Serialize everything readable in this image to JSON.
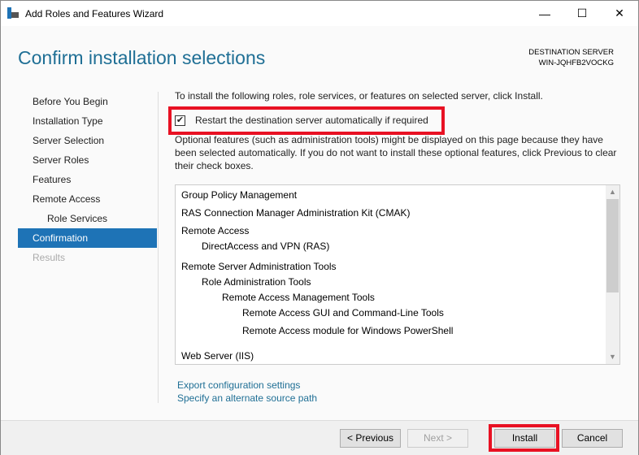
{
  "window": {
    "title": "Add Roles and Features Wizard",
    "minimize": "—",
    "maximize": "☐",
    "close": "✕"
  },
  "header": {
    "title": "Confirm installation selections",
    "destination_label": "DESTINATION SERVER",
    "destination_server": "WIN-JQHFB2VOCKG"
  },
  "nav": [
    "Before You Begin",
    "Installation Type",
    "Server Selection",
    "Server Roles",
    "Features",
    "Remote Access",
    "Role Services",
    "Confirmation",
    "Results"
  ],
  "main": {
    "instruction": "To install the following roles, role services, or features on selected server, click Install.",
    "restart_checkbox": {
      "label": "Restart the destination server automatically if required",
      "checked": true,
      "mark": "✔"
    },
    "note": "Optional features (such as administration tools) might be displayed on this page because they have been selected automatically. If you do not want to install these optional features, click Previous to clear their check boxes.",
    "features": [
      "Group Policy Management",
      "RAS Connection Manager Administration Kit (CMAK)",
      "Remote Access",
      "DirectAccess and VPN (RAS)",
      "Remote Server Administration Tools",
      "Role Administration Tools",
      "Remote Access Management Tools",
      "Remote Access GUI and Command-Line Tools",
      "Remote Access module for Windows PowerShell",
      "Web Server (IIS)"
    ],
    "export_link": "Export configuration settings",
    "alt_source_link": "Specify an alternate source path"
  },
  "buttons": {
    "previous": "< Previous",
    "next": "Next >",
    "install": "Install",
    "cancel": "Cancel"
  },
  "colors": {
    "accent": "#1e73b6",
    "highlight": "#e81123",
    "heading": "#1f6f95"
  }
}
